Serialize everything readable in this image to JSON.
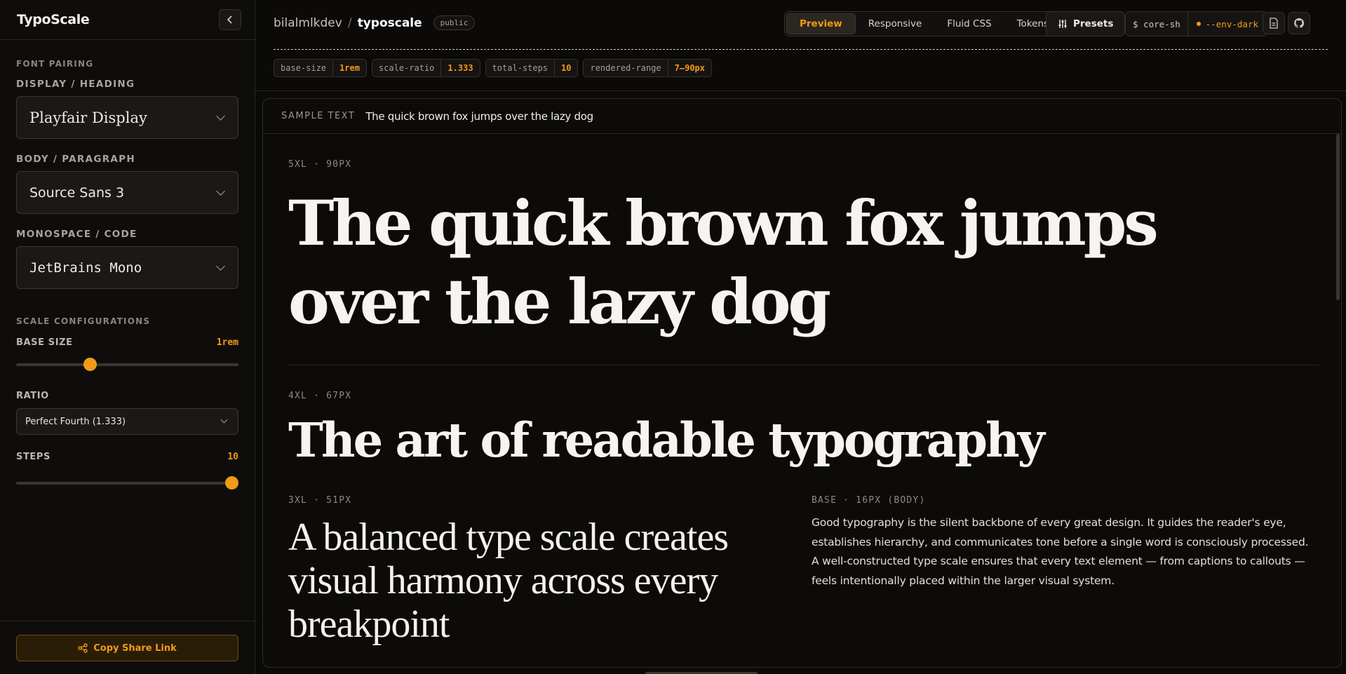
{
  "sidebar": {
    "brand": "TypoScale",
    "collapse_icon": "chevron-left-icon",
    "font_pairing": {
      "section_label": "FONT PAIRING",
      "display_label": "DISPLAY / HEADING",
      "display_value": "Playfair Display",
      "body_label": "BODY / PARAGRAPH",
      "body_value": "Source Sans 3",
      "mono_label": "MONOSPACE / CODE",
      "mono_value": "JetBrains Mono"
    },
    "scale": {
      "section_label": "SCALE CONFIGURATIONS",
      "base_size_label": "BASE SIZE",
      "base_size_value": "1rem",
      "base_size_fraction": 0.34,
      "ratio_label": "RATIO",
      "ratio_value": "Perfect Fourth (1.333)",
      "steps_label": "STEPS",
      "steps_value": "10",
      "steps_fraction": 1.0
    },
    "share_label": "Copy Share Link"
  },
  "header": {
    "user": "bilalmlkdev",
    "separator": "/",
    "repo": "typoscale",
    "visibility": "public",
    "tabs": [
      "Preview",
      "Responsive",
      "Fluid CSS",
      "Tokens"
    ],
    "active_tab": "Preview",
    "presets_label": "Presets",
    "cli_command": "$ core-sh",
    "cli_env": "--env-dark"
  },
  "metrics": [
    {
      "key": "base-size",
      "value": "1rem"
    },
    {
      "key": "scale-ratio",
      "value": "1.333"
    },
    {
      "key": "total-steps",
      "value": "10"
    },
    {
      "key": "rendered-range",
      "value": "7–90px"
    }
  ],
  "preview": {
    "sample_label": "SAMPLE TEXT",
    "sample_text": "The quick brown fox jumps over the lazy dog",
    "blocks": {
      "xl5": {
        "spec": "5XL · 90PX",
        "text": "The quick brown fox jumps over the lazy dog"
      },
      "xl4": {
        "spec": "4XL · 67PX",
        "text": "The art of readable typography"
      },
      "xl3": {
        "spec": "3XL · 51PX",
        "text": "A balanced type scale creates visual harmony across every breakpoint"
      },
      "base": {
        "spec": "BASE · 16PX (BODY)",
        "text": "Good typography is the silent backbone of every great design. It guides the reader's eye, establishes hierarchy, and communicates tone before a single word is consciously processed. A well-constructed type scale ensures that every text element — from captions to callouts — feels intentionally placed within the larger visual system."
      }
    }
  },
  "colors": {
    "accent": "#f29a16",
    "background": "#0b0a09",
    "text": "#f2efea"
  }
}
